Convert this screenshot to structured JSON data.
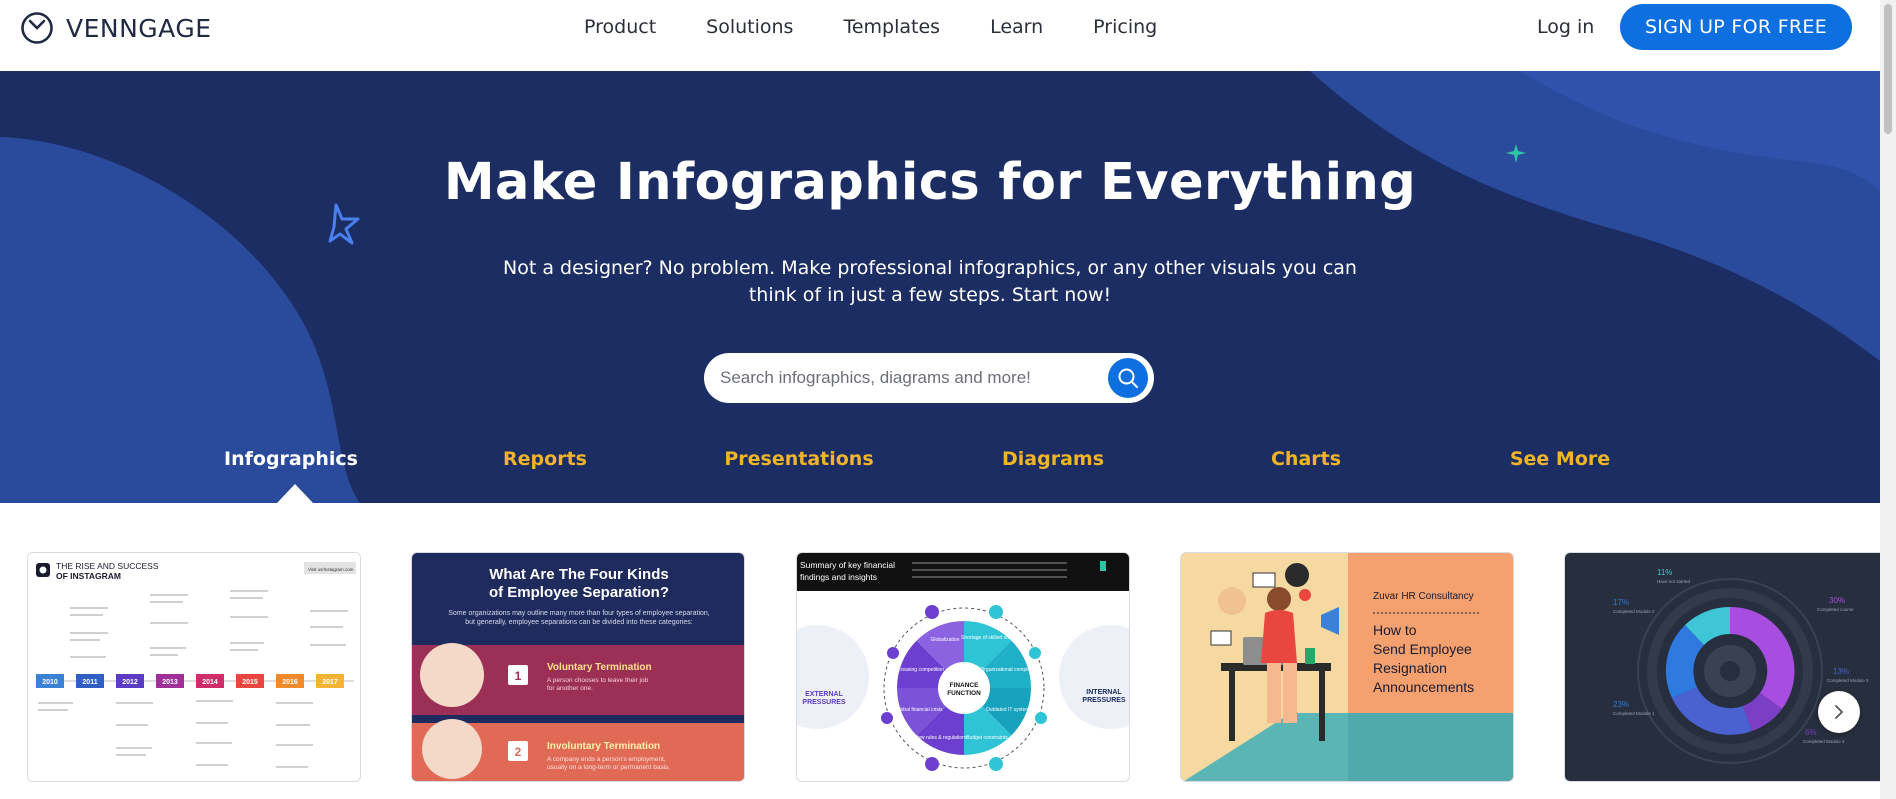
{
  "header": {
    "logo_text": "VENNGAGE",
    "nav": [
      "Product",
      "Solutions",
      "Templates",
      "Learn",
      "Pricing"
    ],
    "login_label": "Log in",
    "signup_label": "SIGN UP FOR FREE"
  },
  "hero": {
    "title": "Make Infographics for Everything",
    "subtitle": "Not a designer? No problem. Make professional infographics, or any other visuals you can think of in just a few steps. Start now!",
    "search_placeholder": "Search infographics, diagrams and more!",
    "tabs": [
      {
        "label": "Infographics",
        "active": true
      },
      {
        "label": "Reports",
        "active": false
      },
      {
        "label": "Presentations",
        "active": false
      },
      {
        "label": "Diagrams",
        "active": false
      },
      {
        "label": "Charts",
        "active": false
      },
      {
        "label": "See More",
        "active": false
      }
    ]
  },
  "cards": [
    {
      "name": "instagram-timeline",
      "title_line1": "THE RISE AND SUCCESS",
      "title_line2": "OF INSTAGRAM",
      "badge": "Visit us/Instagram.com",
      "years": [
        "2010",
        "2011",
        "2012",
        "2013",
        "2014",
        "2015",
        "2016",
        "2017"
      ]
    },
    {
      "name": "employee-separation",
      "title": "What Are The Four Kinds of Employee Separation?",
      "intro": "Some organizations may outline many more than four types of employee separation, but generally, employee separations can be divided into these categories:",
      "item1_num": "1",
      "item1_title": "Voluntary Termination",
      "item1_text": "A person chooses to leave their job for another one.",
      "item2_num": "2",
      "item2_title": "Involuntary Termination",
      "item2_text": "A company ends a person's employment, usually on a long-term or permanent basis."
    },
    {
      "name": "finance-function",
      "title_line1": "Summary of key financial",
      "title_line2": "findings and insights",
      "center_line1": "FINANCE",
      "center_line2": "FUNCTION",
      "left_label_line1": "EXTERNAL",
      "left_label_line2": "PRESSURES",
      "right_label_line1": "INTERNAL",
      "right_label_line2": "PRESSURES",
      "segments": [
        "Globalization",
        "Shortage of skilled staff",
        "Organizational complexity",
        "Outdated IT systems",
        "Budget constraints",
        "New rules & regulations",
        "Global financial crisis",
        "Increasing competition"
      ]
    },
    {
      "name": "hr-resignation",
      "company": "Zuvar HR Consultancy",
      "title": "How to Send Employee Resignation Announcements"
    },
    {
      "name": "donut-chart",
      "labels": [
        {
          "value": "11%",
          "text": "Have not started"
        },
        {
          "value": "17%",
          "text": "Completed Module 2"
        },
        {
          "value": "30%",
          "text": "Completed course"
        },
        {
          "value": "13%",
          "text": "Completed Module 3"
        },
        {
          "value": "23%",
          "text": "Completed Module 1"
        },
        {
          "value": "6%",
          "text": "Completed Module 4"
        }
      ]
    }
  ],
  "colors": {
    "hero_bg": "#1b2d62",
    "accent_blue": "#0e6fe0",
    "tab_yellow": "#f0b429"
  }
}
